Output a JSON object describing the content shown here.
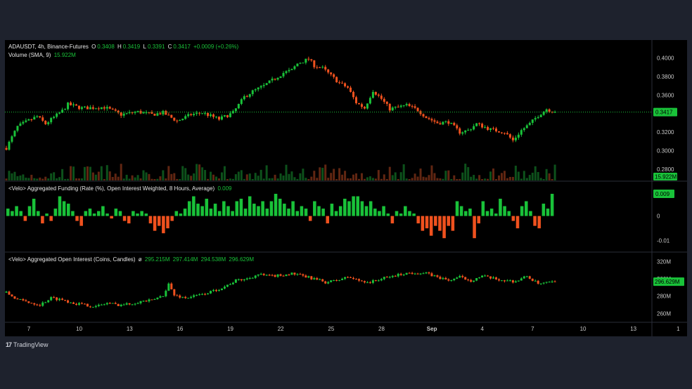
{
  "header": {
    "symbol": "ADAUSDT, 4h, Binance-Futures",
    "o_label": "O",
    "o": "0.3408",
    "h_label": "H",
    "h": "0.3419",
    "l_label": "L",
    "l": "0.3391",
    "c_label": "C",
    "c": "0.3417",
    "change": "+0.0009 (+0.26%)",
    "volume_label": "Volume (SMA, 9)",
    "volume_value": "15.922M"
  },
  "funding_legend": {
    "label": "<Velo> Aggregated Funding (Rate (%), Open Interest Weighted, 8 Hours, Average)",
    "value": "0.009"
  },
  "oi_legend": {
    "label": "<Velo> Aggregated Open Interest (Coins, Candles)",
    "symbol": "ø",
    "o": "295.215M",
    "h": "297.414M",
    "l": "294.538M",
    "c": "296.629M"
  },
  "brand": {
    "name": "TradingView",
    "logo": "17"
  },
  "colors": {
    "up": "#19c239",
    "down": "#f0511e",
    "up_tag": "#19c239",
    "axis_text": "#c8c8c8",
    "grid_sep": "#2a2e39"
  },
  "chart_data": [
    {
      "type": "candlestick",
      "title": "ADAUSDT, 4h, Binance-Futures",
      "y_ticks": [
        "0.4000",
        "0.3800",
        "0.3600",
        "0.3400",
        "0.3200",
        "0.3000",
        "0.2800"
      ],
      "ylim": [
        0.2785,
        0.4043
      ],
      "last_price": "0.3417",
      "x_ticks": [
        "7",
        "10",
        "13",
        "16",
        "19",
        "22",
        "25",
        "28",
        "Sep",
        "4",
        "7",
        "10",
        "13",
        "1"
      ],
      "close_path": [
        [
          0,
          0.303
        ],
        [
          4,
          0.326
        ],
        [
          7,
          0.331
        ],
        [
          11,
          0.337
        ],
        [
          14,
          0.329
        ],
        [
          20,
          0.343
        ],
        [
          22,
          0.35
        ],
        [
          27,
          0.346
        ],
        [
          35,
          0.347
        ],
        [
          38,
          0.343
        ],
        [
          41,
          0.339
        ],
        [
          47,
          0.342
        ],
        [
          52,
          0.339
        ],
        [
          56,
          0.341
        ],
        [
          61,
          0.332
        ],
        [
          66,
          0.339
        ],
        [
          70,
          0.341
        ],
        [
          76,
          0.334
        ],
        [
          81,
          0.341
        ],
        [
          85,
          0.358
        ],
        [
          88,
          0.364
        ],
        [
          92,
          0.37
        ],
        [
          95,
          0.376
        ],
        [
          99,
          0.384
        ],
        [
          102,
          0.387
        ],
        [
          104,
          0.394
        ],
        [
          108,
          0.399
        ],
        [
          110,
          0.392
        ],
        [
          113,
          0.389
        ],
        [
          116,
          0.381
        ],
        [
          119,
          0.373
        ],
        [
          122,
          0.368
        ],
        [
          125,
          0.352
        ],
        [
          128,
          0.346
        ],
        [
          131,
          0.365
        ],
        [
          134,
          0.356
        ],
        [
          137,
          0.345
        ],
        [
          140,
          0.347
        ],
        [
          143,
          0.349
        ],
        [
          147,
          0.344
        ],
        [
          150,
          0.336
        ],
        [
          154,
          0.33
        ],
        [
          158,
          0.331
        ],
        [
          162,
          0.32
        ],
        [
          165,
          0.322
        ],
        [
          168,
          0.329
        ],
        [
          173,
          0.323
        ],
        [
          178,
          0.32
        ],
        [
          181,
          0.311
        ],
        [
          184,
          0.322
        ],
        [
          187,
          0.329
        ],
        [
          190,
          0.338
        ],
        [
          193,
          0.345
        ],
        [
          196,
          0.3417
        ]
      ],
      "volume_label": "Volume (SMA, 9)",
      "volume_last": "15.922M"
    },
    {
      "type": "bar",
      "title": "<Velo> Aggregated Funding (Rate (%), Open Interest Weighted, 8 Hours, Average)",
      "y_ticks": [
        "0.009",
        "0",
        "-0.01"
      ],
      "ylim": [
        -0.0135,
        0.011
      ],
      "last_value": "0.009",
      "values": [
        0.003,
        0.002,
        0.004,
        0.002,
        -0.002,
        0.004,
        0.007,
        0.002,
        -0.003,
        0.001,
        -0.002,
        0.003,
        0.008,
        0.006,
        0.005,
        0.002,
        -0.002,
        -0.004,
        0.002,
        0.003,
        0.001,
        0.002,
        0.004,
        0.001,
        -0.001,
        0.003,
        0.002,
        -0.002,
        -0.003,
        0.002,
        0.001,
        0.002,
        0.001,
        -0.003,
        -0.006,
        -0.004,
        -0.007,
        -0.005,
        -0.002,
        0.002,
        0.001,
        0.003,
        0.006,
        0.008,
        0.005,
        0.004,
        0.007,
        0.003,
        0.005,
        0.002,
        0.006,
        0.004,
        0.002,
        0.006,
        0.007,
        0.003,
        0.008,
        0.005,
        0.004,
        0.006,
        0.003,
        0.006,
        0.009,
        0.007,
        0.005,
        0.003,
        0.006,
        0.002,
        0.004,
        0.003,
        -0.002,
        0.006,
        0.004,
        0.003,
        -0.003,
        0.005,
        0.002,
        0.004,
        0.007,
        0.006,
        0.008,
        0.008,
        0.006,
        0.004,
        0.006,
        0.003,
        0.002,
        0.004,
        0.001,
        -0.003,
        0.002,
        0.001,
        0.004,
        0.002,
        0.001,
        -0.003,
        -0.006,
        -0.005,
        -0.008,
        -0.004,
        -0.006,
        -0.009,
        -0.004,
        -0.006,
        0.006,
        0.004,
        0.002,
        0.003,
        -0.009,
        -0.003,
        0.006,
        0.002,
        0.003,
        0.001,
        0.007,
        0.004,
        0.002,
        -0.002,
        -0.005,
        0.004,
        0.006,
        0.002,
        -0.004,
        -0.005,
        0.005,
        0.003,
        0.009
      ]
    },
    {
      "type": "candlestick",
      "title": "<Velo> Aggregated Open Interest (Coins, Candles)",
      "y_ticks": [
        "320M",
        "300M",
        "280M",
        "260M"
      ],
      "ylim": [
        251.5,
        328.3
      ],
      "last_value": "296.629M",
      "x_ticks": [
        "7",
        "10",
        "13",
        "16",
        "19",
        "22",
        "25",
        "28",
        "Sep",
        "4",
        "7",
        "10",
        "13",
        "1"
      ],
      "close_path": [
        [
          0,
          284
        ],
        [
          4,
          276
        ],
        [
          8,
          273
        ],
        [
          12,
          270
        ],
        [
          16,
          278
        ],
        [
          20,
          276
        ],
        [
          24,
          272
        ],
        [
          28,
          270
        ],
        [
          32,
          268
        ],
        [
          36,
          272
        ],
        [
          40,
          270
        ],
        [
          44,
          271
        ],
        [
          48,
          274
        ],
        [
          52,
          275
        ],
        [
          56,
          281
        ],
        [
          58,
          294
        ],
        [
          60,
          281
        ],
        [
          64,
          278
        ],
        [
          70,
          282
        ],
        [
          74,
          286
        ],
        [
          78,
          291
        ],
        [
          82,
          298
        ],
        [
          86,
          300
        ],
        [
          90,
          305
        ],
        [
          94,
          303
        ],
        [
          98,
          304
        ],
        [
          102,
          306
        ],
        [
          106,
          303
        ],
        [
          110,
          300
        ],
        [
          114,
          296
        ],
        [
          118,
          298
        ],
        [
          122,
          302
        ],
        [
          126,
          298
        ],
        [
          130,
          296
        ],
        [
          134,
          300
        ],
        [
          138,
          303
        ],
        [
          142,
          306
        ],
        [
          146,
          307
        ],
        [
          150,
          306
        ],
        [
          154,
          302
        ],
        [
          158,
          298
        ],
        [
          162,
          302
        ],
        [
          166,
          298
        ],
        [
          170,
          303
        ],
        [
          174,
          300
        ],
        [
          178,
          298
        ],
        [
          182,
          297
        ],
        [
          186,
          303
        ],
        [
          190,
          294
        ],
        [
          193,
          295
        ],
        [
          196,
          296.6
        ]
      ]
    }
  ]
}
